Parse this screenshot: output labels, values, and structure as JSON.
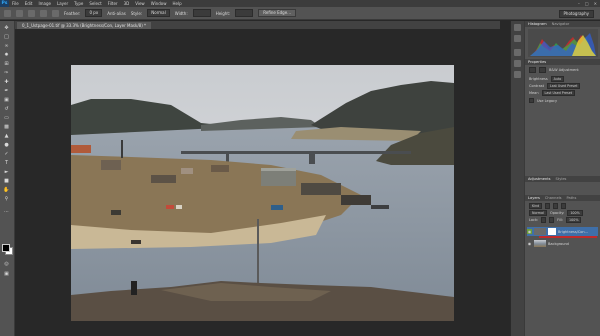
{
  "menubar": {
    "logo": "Ps",
    "items": [
      "File",
      "Edit",
      "Image",
      "Layer",
      "Type",
      "Select",
      "Filter",
      "3D",
      "View",
      "Window",
      "Help"
    ]
  },
  "options": {
    "feather_label": "Feather:",
    "feather_value": "0 px",
    "antialias_label": "Anti-alias",
    "style_label": "Style:",
    "style_value": "Normal",
    "width_label": "Width:",
    "height_label": "Height:",
    "refine_button": "Refine Edge...",
    "workspace": "Photography"
  },
  "document": {
    "tab_title": "0_1_Ustpage-01.tif @ 33.3% (Brightness/Con, Layer Mask/8) *"
  },
  "panels": {
    "histogram_tabs": [
      "Histogram",
      "Navigator"
    ],
    "properties_title": "Properties",
    "properties_layer": "B&W Adjustment",
    "properties_rows": [
      {
        "label": "Brightness",
        "value": "Auto"
      },
      {
        "label": "Contrast",
        "value": "Last Used Preset"
      },
      {
        "label": "Mean",
        "value": "Last Used Preset"
      }
    ],
    "legacy_label": "Use Legacy",
    "adjust_tabs": [
      "Adjustments",
      "Styles"
    ],
    "layers_tabs": [
      "Layers",
      "Channels",
      "Paths"
    ],
    "kind_label": "Kind",
    "blend_mode": "Normal",
    "opacity_label": "Opacity:",
    "opacity_value": "100%",
    "lock_label": "Lock:",
    "fill_label": "Fill:",
    "fill_value": "100%",
    "layers": [
      {
        "name": "Brightness/Con...",
        "selected": true
      },
      {
        "name": "Background",
        "selected": false
      }
    ]
  }
}
